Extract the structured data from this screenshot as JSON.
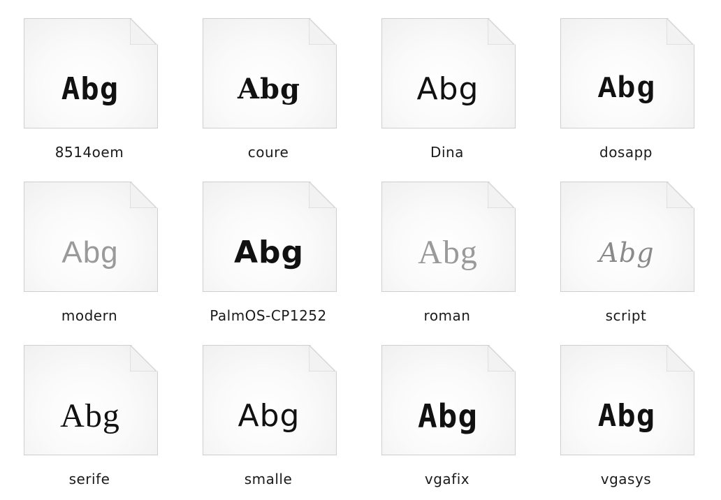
{
  "files": [
    {
      "name": "8514oem",
      "preview": "Abg",
      "icon": "font-file-icon"
    },
    {
      "name": "coure",
      "preview": "Abg",
      "icon": "font-file-icon"
    },
    {
      "name": "Dina",
      "preview": "Abg",
      "icon": "font-file-icon"
    },
    {
      "name": "dosapp",
      "preview": "Abg",
      "icon": "font-file-icon"
    },
    {
      "name": "modern",
      "preview": "Abg",
      "icon": "font-file-icon"
    },
    {
      "name": "PalmOS-CP1252",
      "preview": "Abg",
      "icon": "font-file-icon"
    },
    {
      "name": "roman",
      "preview": "Abg",
      "icon": "font-file-icon"
    },
    {
      "name": "script",
      "preview": "Abg",
      "icon": "font-file-icon"
    },
    {
      "name": "serife",
      "preview": "Abg",
      "icon": "font-file-icon"
    },
    {
      "name": "smalle",
      "preview": "Abg",
      "icon": "font-file-icon"
    },
    {
      "name": "vgafix",
      "preview": "Abg",
      "icon": "font-file-icon"
    },
    {
      "name": "vgasys",
      "preview": "Abg",
      "icon": "font-file-icon"
    }
  ]
}
